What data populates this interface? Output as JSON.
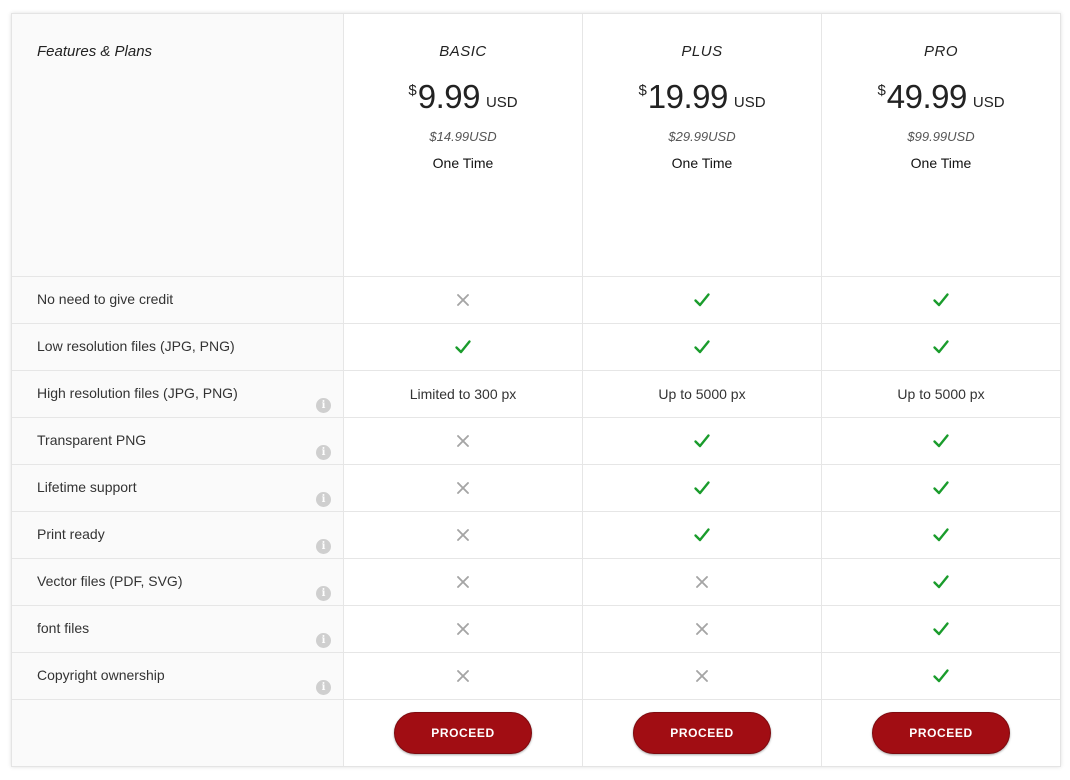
{
  "header": {
    "label": "Features & Plans"
  },
  "plans": [
    {
      "name": "BASIC",
      "currency": "$",
      "price": "9.99",
      "unit": "USD",
      "old_price": "$14.99USD",
      "term": "One Time",
      "button": "PROCEED"
    },
    {
      "name": "PLUS",
      "currency": "$",
      "price": "19.99",
      "unit": "USD",
      "old_price": "$29.99USD",
      "term": "One Time",
      "button": "PROCEED"
    },
    {
      "name": "PRO",
      "currency": "$",
      "price": "49.99",
      "unit": "USD",
      "old_price": "$99.99USD",
      "term": "One Time",
      "button": "PROCEED"
    }
  ],
  "features": [
    {
      "label": "No need to give credit",
      "info": false,
      "values": [
        "cross",
        "check",
        "check"
      ]
    },
    {
      "label": "Low resolution files (JPG, PNG)",
      "info": false,
      "values": [
        "check",
        "check",
        "check"
      ]
    },
    {
      "label": "High resolution files (JPG, PNG)",
      "info": true,
      "values": [
        "Limited to 300 px",
        "Up to 5000 px",
        "Up to 5000 px"
      ]
    },
    {
      "label": "Transparent PNG",
      "info": true,
      "values": [
        "cross",
        "check",
        "check"
      ]
    },
    {
      "label": "Lifetime support",
      "info": true,
      "values": [
        "cross",
        "check",
        "check"
      ]
    },
    {
      "label": "Print ready",
      "info": true,
      "values": [
        "cross",
        "check",
        "check"
      ]
    },
    {
      "label": "Vector files (PDF, SVG)",
      "info": true,
      "values": [
        "cross",
        "cross",
        "check"
      ]
    },
    {
      "label": "font files",
      "info": true,
      "values": [
        "cross",
        "cross",
        "check"
      ]
    },
    {
      "label": "Copyright ownership",
      "info": true,
      "values": [
        "cross",
        "cross",
        "check"
      ]
    }
  ],
  "info_glyph": "i",
  "icons": {
    "check": "check-icon",
    "cross": "cross-icon",
    "info": "info-icon"
  },
  "colors": {
    "check": "#1a9c2c",
    "cross": "#a5a5a5",
    "button": "#a10d13",
    "info": "#cfcfcf"
  }
}
